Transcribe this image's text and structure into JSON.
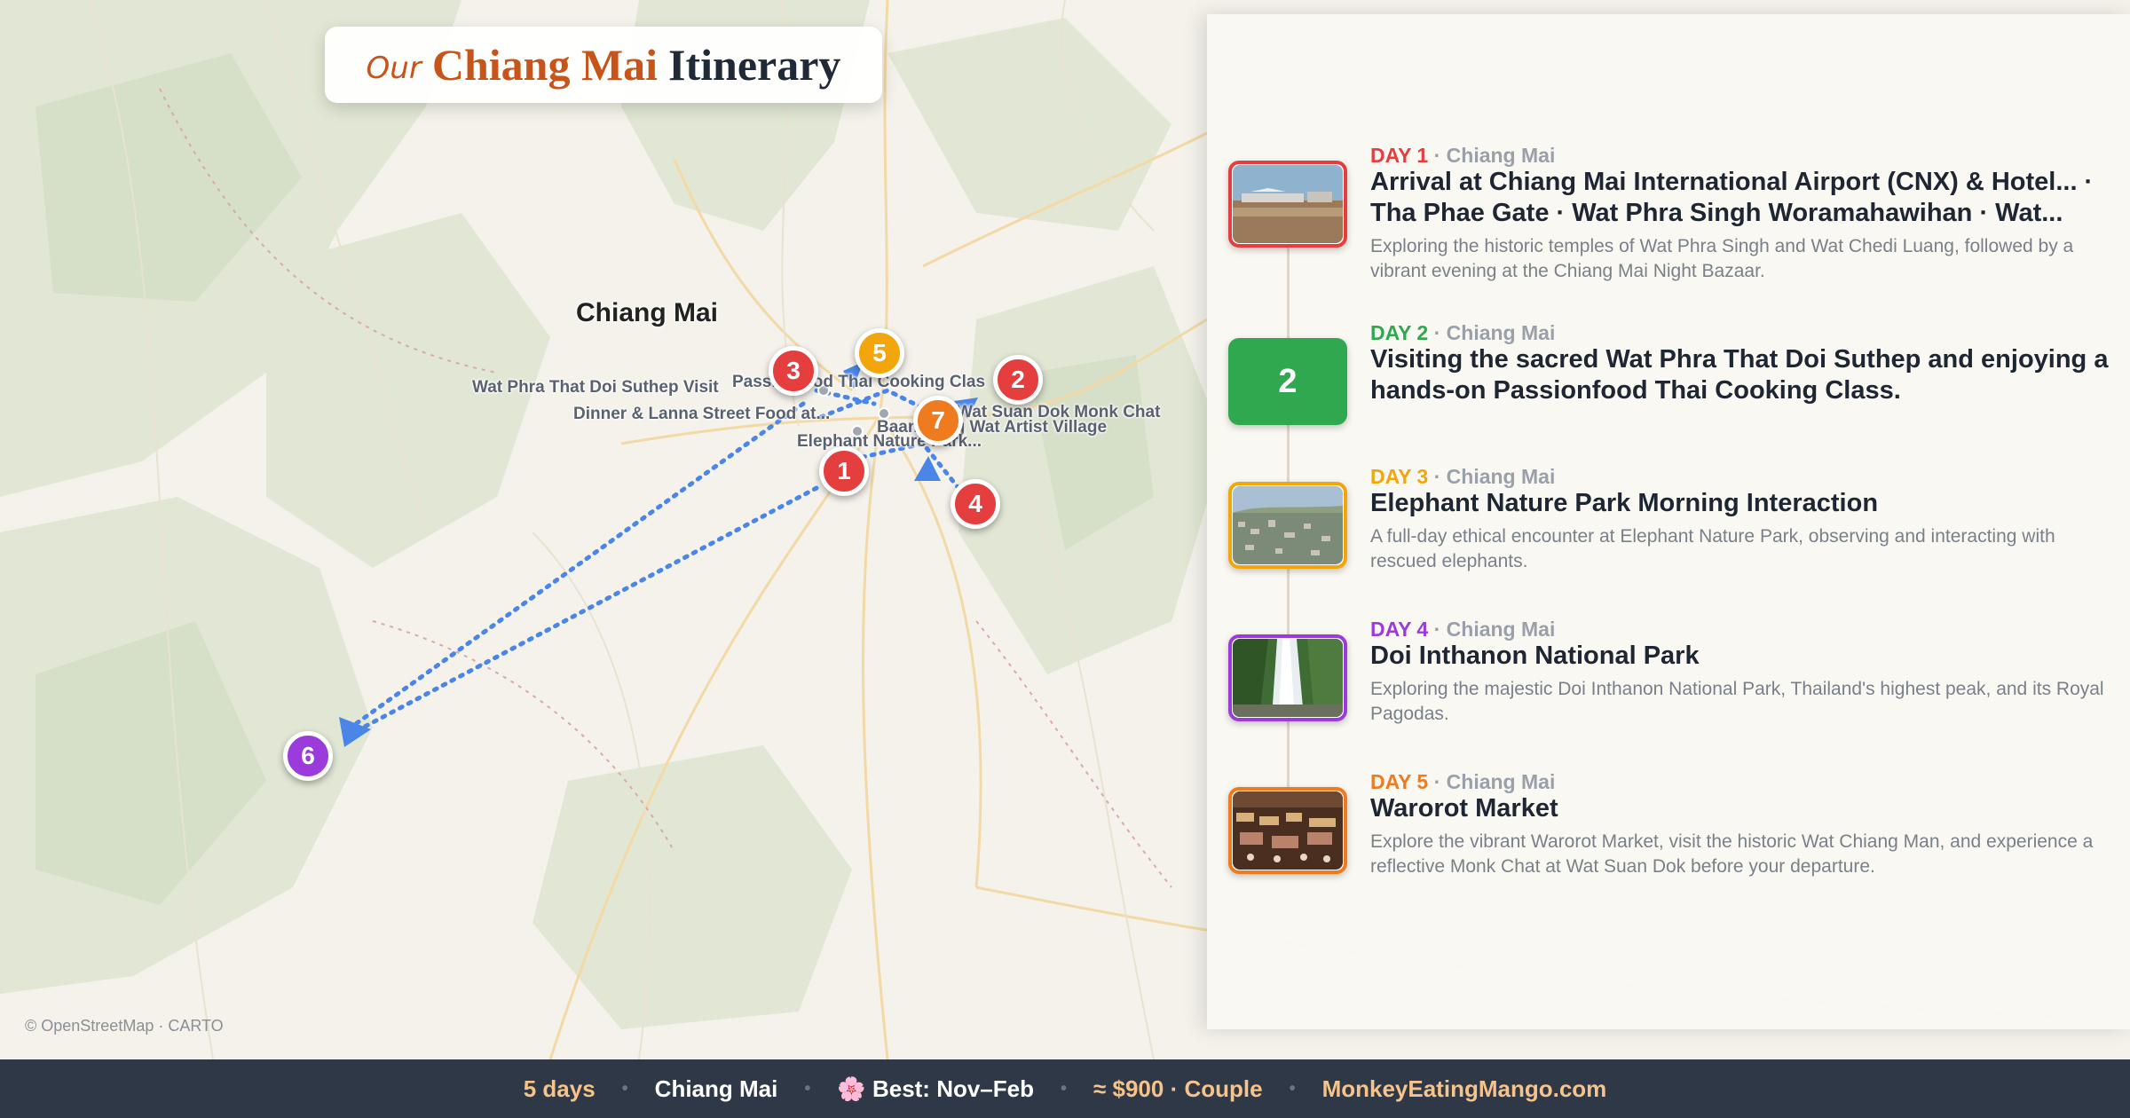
{
  "title": {
    "prefix": "Our",
    "city": "Chiang Mai",
    "rest": "Itinerary"
  },
  "map": {
    "city_label": "Chiang Mai",
    "attribution": "© OpenStreetMap · CARTO",
    "place_labels": [
      "Wat Phra That Doi Suthep Visit",
      "Dinner & Lanna Street Food at...",
      "Passionfood Thai Cooking Clas",
      "Wat Suan Dok Monk Chat",
      "Baan Kang Wat Artist Village",
      "Elephant Nature Park..."
    ],
    "markers": [
      {
        "label": "1",
        "color": "#e53e3e"
      },
      {
        "label": "2",
        "color": "#e53e3e"
      },
      {
        "label": "3",
        "color": "#e53e3e"
      },
      {
        "label": "4",
        "color": "#e53e3e"
      },
      {
        "label": "5",
        "color": "#f2a60c"
      },
      {
        "label": "6",
        "color": "#9b3bdc"
      },
      {
        "label": "7",
        "color": "#f07a1e"
      }
    ]
  },
  "days": [
    {
      "day": "DAY 1",
      "location": "Chiang Mai",
      "color": "#e53e3e",
      "title": "Arrival at Chiang Mai International Airport (CNX) & Hotel... · Tha Phae Gate · Wat Phra Singh Woramahawihan · Wat...",
      "desc": "Exploring the historic temples of Wat Phra Singh and Wat Chedi Luang, followed by a vibrant evening at the Chiang Mai Night Bazaar.",
      "thumb": "airport"
    },
    {
      "day": "DAY 2",
      "location": "Chiang Mai",
      "color": "#2fa84f",
      "title": "Visiting the sacred Wat Phra That Doi Suthep and enjoying a hands-on Passionfood Thai Cooking Class.",
      "desc": "",
      "thumb_number": "2"
    },
    {
      "day": "DAY 3",
      "location": "Chiang Mai",
      "color": "#f2a60c",
      "title": "Elephant Nature Park Morning Interaction",
      "desc": "A full-day ethical encounter at Elephant Nature Park, observing and interacting with rescued elephants.",
      "thumb": "city"
    },
    {
      "day": "DAY 4",
      "location": "Chiang Mai",
      "color": "#9b3bdc",
      "title": "Doi Inthanon National Park",
      "desc": "Exploring the majestic Doi Inthanon National Park, Thailand's highest peak, and its Royal Pagodas.",
      "thumb": "waterfall"
    },
    {
      "day": "DAY 5",
      "location": "Chiang Mai",
      "color": "#f07a1e",
      "title": "Warorot Market",
      "desc": "Explore the vibrant Warorot Market, visit the historic Wat Chiang Man, and experience a reflective Monk Chat at Wat Suan Dok before your departure.",
      "thumb": "market"
    }
  ],
  "footer": {
    "duration": "5 days",
    "city": "Chiang Mai",
    "best": "🌸 Best: Nov–Feb",
    "budget": "≈ $900 · Couple",
    "site": "MonkeyEatingMango.com",
    "colors": {
      "duration": "#f6c38a",
      "city": "#ffffff",
      "best": "#ffffff",
      "budget": "#f6c38a",
      "site": "#f6c38a"
    }
  },
  "route_color": "#4a86e8"
}
